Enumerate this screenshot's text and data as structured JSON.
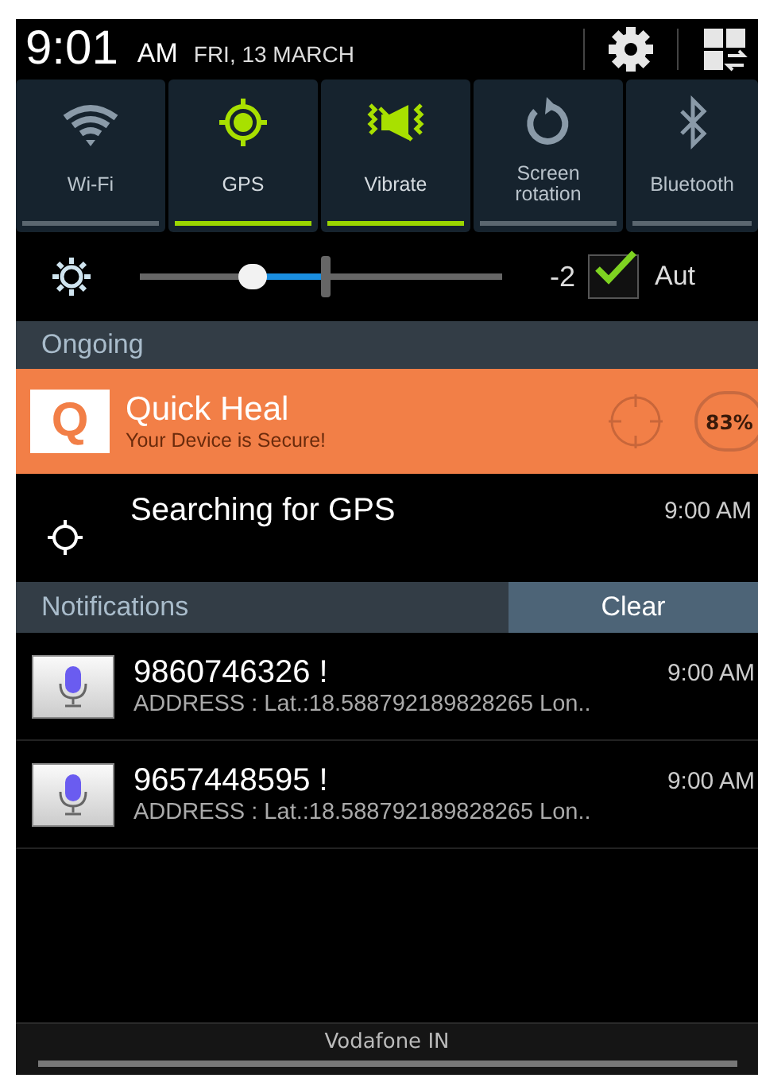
{
  "status_bar": {
    "time": "9:01",
    "ampm": "AM",
    "date": "FRI, 13 MARCH"
  },
  "quick_settings": [
    {
      "label": "Wi-Fi",
      "kind": "wifi",
      "on": false
    },
    {
      "label": "GPS",
      "kind": "gps",
      "on": true
    },
    {
      "label": "Vibrate",
      "kind": "vibrate",
      "on": true
    },
    {
      "label": "Screen rotation",
      "kind": "rotation",
      "on": false
    },
    {
      "label": "Bluetooth",
      "kind": "bluetooth",
      "on": false
    }
  ],
  "brightness": {
    "level": 0.31,
    "reading": "-2",
    "auto_checked": true,
    "auto_label": "Aut"
  },
  "ongoing": {
    "header": "Ongoing",
    "app": {
      "logo": "Q",
      "title": "Quick Heal",
      "subtitle": "Your Device is Secure!",
      "badge": "83%"
    },
    "gps": {
      "title": "Searching for GPS",
      "time": "9:00 AM"
    }
  },
  "notifications": {
    "header": "Notifications",
    "clear": "Clear",
    "items": [
      {
        "title": "9860746326 !",
        "time": "9:00 AM",
        "text": "ADDRESS : Lat.:18.588792189828265 Lon.."
      },
      {
        "title": "9657448595 !",
        "time": "9:00 AM",
        "text": "ADDRESS : Lat.:18.588792189828265 Lon.."
      }
    ]
  },
  "carrier": "Vodafone IN"
}
